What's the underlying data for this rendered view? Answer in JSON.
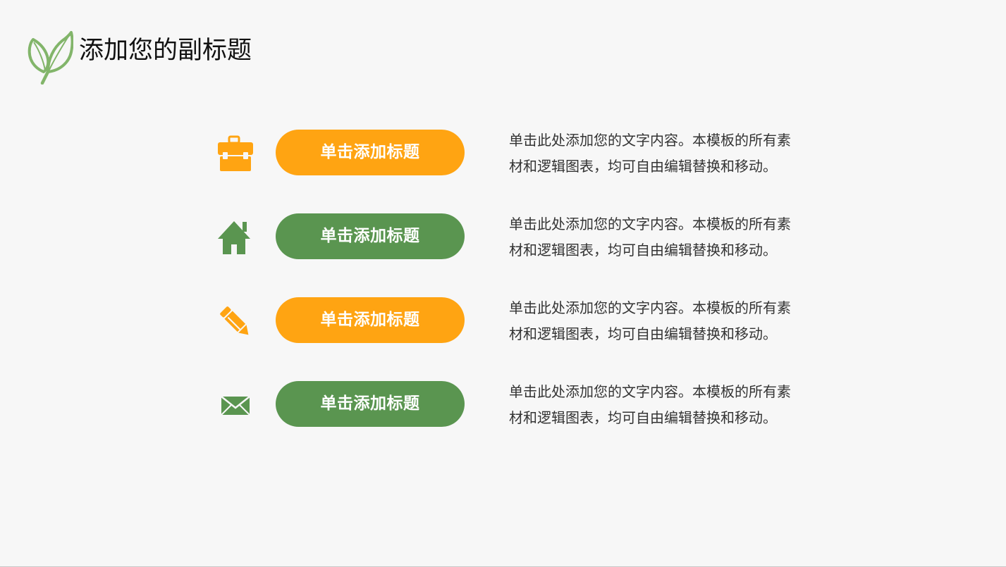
{
  "header": {
    "subtitle": "添加您的副标题",
    "logo_icon": "leaf-icon",
    "logo_color": "#82b56a"
  },
  "colors": {
    "orange": "#ffa412",
    "green": "#5a9550",
    "background": "#f7f7f7",
    "text": "#333333"
  },
  "items": [
    {
      "icon": "briefcase-icon",
      "color": "orange",
      "button_label": "单击添加标题",
      "desc_line1": "单击此处添加您的文字内容。本模板的所有素",
      "desc_line2": "材和逻辑图表，均可自由编辑替换和移动。"
    },
    {
      "icon": "house-icon",
      "color": "green",
      "button_label": "单击添加标题",
      "desc_line1": "单击此处添加您的文字内容。本模板的所有素",
      "desc_line2": "材和逻辑图表，均可自由编辑替换和移动。"
    },
    {
      "icon": "pencil-icon",
      "color": "orange",
      "button_label": "单击添加标题",
      "desc_line1": "单击此处添加您的文字内容。本模板的所有素",
      "desc_line2": "材和逻辑图表，均可自由编辑替换和移动。"
    },
    {
      "icon": "envelope-icon",
      "color": "green",
      "button_label": "单击添加标题",
      "desc_line1": "单击此处添加您的文字内容。本模板的所有素",
      "desc_line2": "材和逻辑图表，均可自由编辑替换和移动。"
    }
  ]
}
